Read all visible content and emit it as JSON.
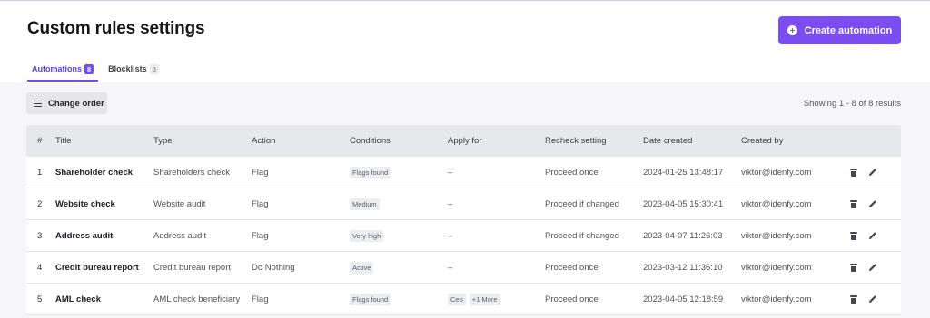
{
  "header": {
    "title": "Custom rules settings",
    "create_label": "Create automation"
  },
  "tabs": [
    {
      "label": "Automations",
      "count": "8",
      "active": true
    },
    {
      "label": "Blocklists",
      "count": "0",
      "active": false
    }
  ],
  "toolbar": {
    "change_order_label": "Change order",
    "showing_text": "Showing 1 - 8 of 8 results"
  },
  "table": {
    "columns": [
      "#",
      "Title",
      "Type",
      "Action",
      "Conditions",
      "Apply for",
      "Recheck setting",
      "Date created",
      "Created by"
    ],
    "rows": [
      {
        "num": "1",
        "title": "Shareholder check",
        "type": "Shareholders check",
        "action": "Flag",
        "conditions": [
          "Flags found"
        ],
        "apply_for": [
          "–"
        ],
        "recheck": "Proceed once",
        "date": "2024-01-25 13:48:17",
        "created_by": "viktor@idenfy.com"
      },
      {
        "num": "2",
        "title": "Website check",
        "type": "Website audit",
        "action": "Flag",
        "conditions": [
          "Medium"
        ],
        "apply_for": [
          "–"
        ],
        "recheck": "Proceed if changed",
        "date": "2023-04-05 15:30:41",
        "created_by": "viktor@idenfy.com"
      },
      {
        "num": "3",
        "title": "Address audit",
        "type": "Address audit",
        "action": "Flag",
        "conditions": [
          "Very high"
        ],
        "apply_for": [
          "–"
        ],
        "recheck": "Proceed if changed",
        "date": "2023-04-07 11:26:03",
        "created_by": "viktor@idenfy.com"
      },
      {
        "num": "4",
        "title": "Credit bureau report",
        "type": "Credit bureau report",
        "action": "Do Nothing",
        "conditions": [
          "Active"
        ],
        "apply_for": [
          "–"
        ],
        "recheck": "Proceed once",
        "date": "2023-03-12 11:36:10",
        "created_by": "viktor@idenfy.com"
      },
      {
        "num": "5",
        "title": "AML check",
        "type": "AML check beneficiary",
        "action": "Flag",
        "conditions": [
          "Flags found"
        ],
        "apply_for": [
          "Ceo",
          "+1 More"
        ],
        "recheck": "Proceed once",
        "date": "2023-04-05 12:18:59",
        "created_by": "viktor@idenfy.com"
      }
    ]
  },
  "icons": {
    "create": "plus-circle-icon",
    "change_order": "list-icon",
    "row_delete": "trash-icon",
    "row_edit": "pencil-icon"
  },
  "colors": {
    "accent": "#7b4df0",
    "content_bg": "#f6f6f8",
    "table_header_bg": "#e7e8eb"
  }
}
